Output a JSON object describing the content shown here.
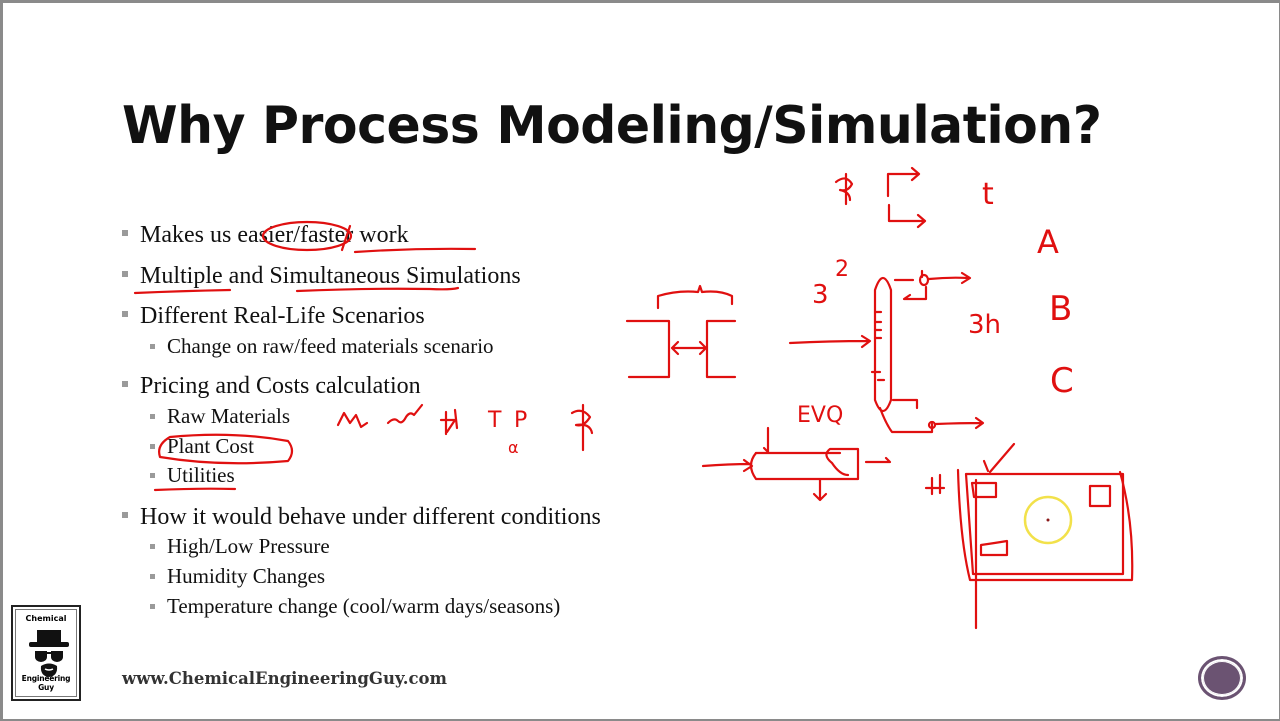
{
  "slide": {
    "title": "Why Process Modeling/Simulation?",
    "bullets": [
      {
        "level": 1,
        "text": "Makes us easier/faster work"
      },
      {
        "level": 1,
        "text": "Multiple and Simultaneous Simulations"
      },
      {
        "level": 1,
        "text": "Different Real-Life Scenarios"
      },
      {
        "level": 2,
        "text": "Change on raw/feed materials scenario"
      },
      {
        "level": 1,
        "text": "Pricing and Costs calculation"
      },
      {
        "level": 2,
        "text": "Raw Materials"
      },
      {
        "level": 2,
        "text": "Plant Cost"
      },
      {
        "level": 2,
        "text": "Utilities"
      },
      {
        "level": 1,
        "text": "How it would behave under different conditions"
      },
      {
        "level": 2,
        "text": "High/Low Pressure"
      },
      {
        "level": 2,
        "text": "Humidity Changes"
      },
      {
        "level": 2,
        "text": "Temperature change (cool/warm days/seasons)"
      }
    ],
    "footer": {
      "website": "www.ChemicalEngineeringGuy.com",
      "logo_top": "Chemical",
      "logo_bottom": "Engineering Guy"
    }
  },
  "annotations": {
    "color": "#e01010",
    "handwritten_labels": [
      "$",
      "t",
      "A",
      "B",
      "C",
      "3",
      "2",
      "3h",
      "EVQ",
      "T",
      "P",
      "Q"
    ]
  },
  "colors": {
    "accent": "#6b5372",
    "border": "#8a8a8a",
    "bullet": "#9a9a9a",
    "ink": "#e01010",
    "cursor_highlight": "#f2e14a"
  }
}
